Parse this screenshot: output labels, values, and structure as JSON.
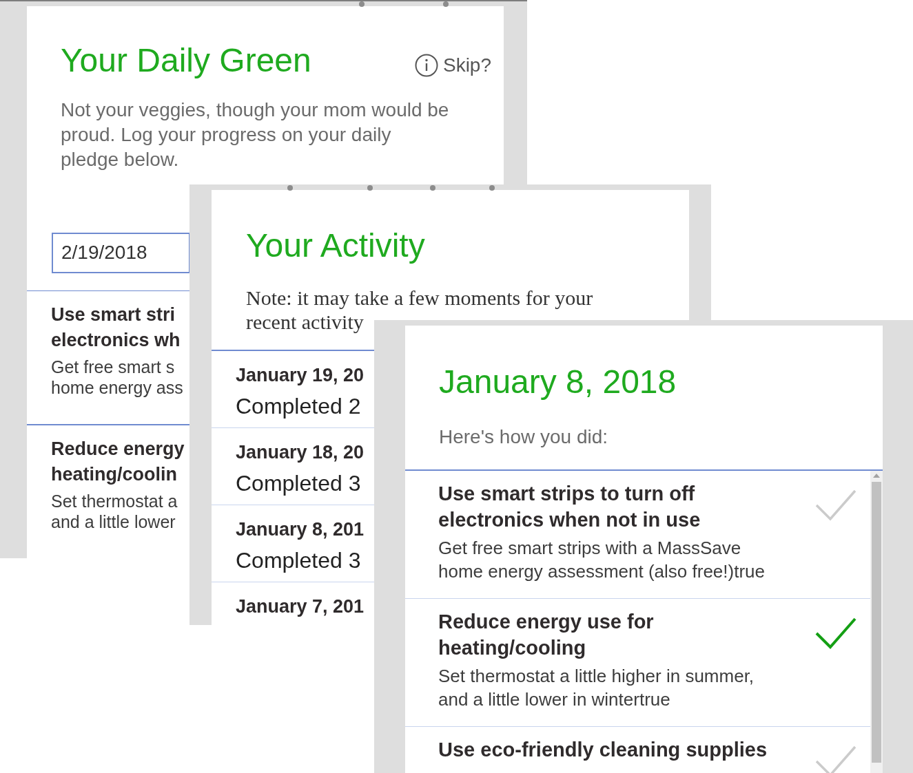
{
  "daily_green": {
    "title": "Your Daily Green",
    "skip": "Skip?",
    "intro": [
      "Not your veggies, though your mom would be",
      "proud. Log your progress on your daily",
      "pledge below."
    ],
    "date_field": {
      "value": "2/19/2018"
    },
    "pledges": [
      {
        "title": [
          "Use smart stri",
          "electronics wh"
        ],
        "description": [
          "Get free smart s",
          "home energy ass"
        ]
      },
      {
        "title": [
          "Reduce energy",
          "heating/coolin"
        ],
        "description": [
          "Set thermostat a",
          "and a little lower"
        ]
      }
    ]
  },
  "activity": {
    "title": "Your Activity",
    "note": [
      "Note: it may take a few moments for your",
      "recent activity"
    ],
    "days": [
      {
        "date": "January 19, 20",
        "summary": "Completed 2"
      },
      {
        "date": "January 18, 20",
        "summary": "Completed 3"
      },
      {
        "date": "January 8, 201",
        "summary": "Completed 3"
      },
      {
        "date": "January 7, 201"
      }
    ]
  },
  "day_detail": {
    "title": "January 8, 2018",
    "subtitle": "Here's how you did:",
    "items": [
      {
        "title": [
          "Use smart strips to turn off",
          "electronics when not in use"
        ],
        "description": [
          "Get free smart strips with a MassSave",
          "home energy assessment (also free!)true"
        ],
        "checked": false
      },
      {
        "title": [
          "Reduce energy use for",
          "heating/cooling"
        ],
        "description": [
          "Set thermostat a little higher in summer,",
          "and a little lower in wintertrue"
        ],
        "checked": true
      },
      {
        "title": [
          "Use eco-friendly cleaning supplies"
        ],
        "checked": false
      }
    ]
  }
}
